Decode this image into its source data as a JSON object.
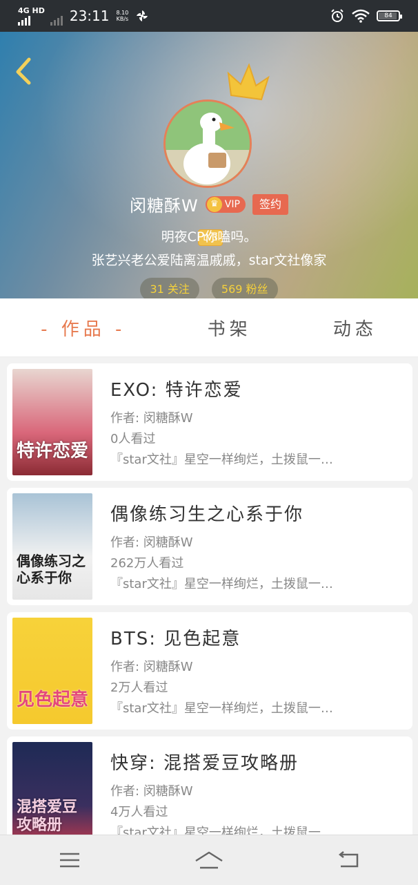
{
  "status_bar": {
    "network": "4G HD",
    "time": "23:11",
    "speed_value": "8.10",
    "speed_unit": "KB/s",
    "battery": "84"
  },
  "profile": {
    "level": "LV3",
    "name": "闵糖酥W",
    "vip_label": "VIP",
    "sign_label": "签约",
    "bio_line1": "明夜CP你嗑吗。",
    "bio_line2": "张艺兴老公爱陆离温戚戚，star文社像家",
    "following": "31 关注",
    "fans": "569 粉丝"
  },
  "tabs": [
    {
      "label": "- 作品 -",
      "active": true
    },
    {
      "label": "书架",
      "active": false
    },
    {
      "label": "动态",
      "active": false
    }
  ],
  "works": [
    {
      "title": "EXO: 特许恋爱",
      "author": "作者: 闵糖酥W",
      "views": "0人看过",
      "summary": "『star文社』星空一样绚烂，土拨鼠一…",
      "cover_text": "特许恋爱",
      "cover_color": "#d9677a"
    },
    {
      "title": "偶像练习生之心系于你",
      "author": "作者: 闵糖酥W",
      "views": "262万人看过",
      "summary": "『star文社』星空一样绚烂，土拨鼠一…",
      "cover_text": "偶像练习之心系于你",
      "cover_color": "#5c7fa0"
    },
    {
      "title": "BTS: 见色起意",
      "author": "作者: 闵糖酥W",
      "views": "2万人看过",
      "summary": "『star文社』星空一样绚烂，土拨鼠一…",
      "cover_text": "见色起意",
      "cover_color": "#f7d23a"
    },
    {
      "title": "快穿: 混搭爱豆攻略册",
      "author": "作者: 闵糖酥W",
      "views": "4万人看过",
      "summary": "『star文社』星空一样绚烂，土拨鼠一…",
      "cover_text": "混搭爱豆攻略册",
      "cover_color": "#2b3a67"
    }
  ],
  "colors": {
    "accent": "#e77a4f",
    "fans_text": "#f5d13b"
  }
}
